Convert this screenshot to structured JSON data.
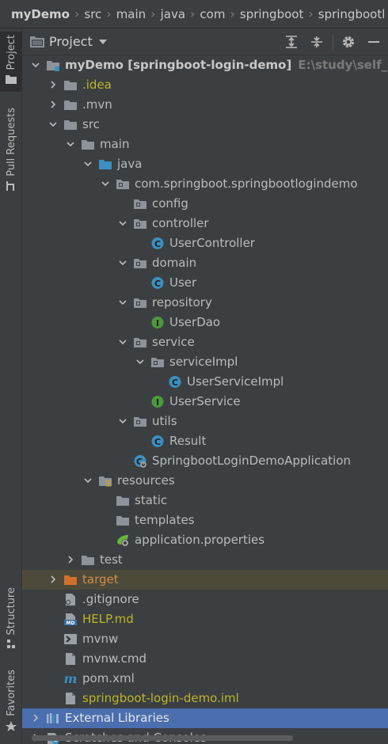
{
  "breadcrumb": [
    "myDemo",
    "src",
    "main",
    "java",
    "com",
    "springboot",
    "springbootl"
  ],
  "stripe": {
    "project": "Project",
    "pull_requests": "Pull Requests",
    "structure": "Structure",
    "favorites": "Favorites"
  },
  "panel": {
    "title": "Project"
  },
  "tree": [
    {
      "label": "myDemo",
      "suffix": " [springboot-login-demo]",
      "path": "E:\\study\\self_study\\",
      "icon": "module",
      "expanded": true,
      "depth": 0,
      "style": "bold"
    },
    {
      "label": ".idea",
      "icon": "folder",
      "expanded": false,
      "depth": 1,
      "style": "yellow"
    },
    {
      "label": ".mvn",
      "icon": "folder",
      "expanded": false,
      "depth": 1
    },
    {
      "label": "src",
      "icon": "folder",
      "expanded": true,
      "depth": 1
    },
    {
      "label": "main",
      "icon": "folder",
      "expanded": true,
      "depth": 2
    },
    {
      "label": "java",
      "icon": "folder-blue",
      "expanded": true,
      "depth": 3
    },
    {
      "label": "com.springboot.springbootlogindemo",
      "icon": "package",
      "expanded": true,
      "depth": 4
    },
    {
      "label": "config",
      "icon": "package",
      "depth": 5
    },
    {
      "label": "controller",
      "icon": "package",
      "expanded": true,
      "depth": 5
    },
    {
      "label": "UserController",
      "icon": "class",
      "depth": 6
    },
    {
      "label": "domain",
      "icon": "package",
      "expanded": true,
      "depth": 5
    },
    {
      "label": "User",
      "icon": "class",
      "depth": 6
    },
    {
      "label": "repository",
      "icon": "package",
      "expanded": true,
      "depth": 5
    },
    {
      "label": "UserDao",
      "icon": "interface",
      "depth": 6
    },
    {
      "label": "service",
      "icon": "package",
      "expanded": true,
      "depth": 5
    },
    {
      "label": "serviceImpl",
      "icon": "package",
      "expanded": true,
      "depth": 6
    },
    {
      "label": "UserServiceImpl",
      "icon": "class",
      "depth": 7
    },
    {
      "label": "UserService",
      "icon": "interface",
      "depth": 6
    },
    {
      "label": "utils",
      "icon": "package",
      "expanded": true,
      "depth": 5
    },
    {
      "label": "Result",
      "icon": "class",
      "depth": 6
    },
    {
      "label": "SpringbootLoginDemoApplication",
      "icon": "spring-class",
      "depth": 5
    },
    {
      "label": "resources",
      "icon": "resources-folder",
      "expanded": true,
      "depth": 3
    },
    {
      "label": "static",
      "icon": "folder",
      "depth": 4
    },
    {
      "label": "templates",
      "icon": "folder",
      "depth": 4
    },
    {
      "label": "application.properties",
      "icon": "spring-properties",
      "depth": 4
    },
    {
      "label": "test",
      "icon": "folder",
      "expanded": false,
      "depth": 2
    },
    {
      "label": "target",
      "icon": "folder-orange",
      "expanded": false,
      "depth": 1,
      "style": "orange",
      "row": "hover"
    },
    {
      "label": ".gitignore",
      "icon": "gitignore",
      "depth": 1
    },
    {
      "label": "HELP.md",
      "icon": "markdown",
      "depth": 1,
      "style": "yellow"
    },
    {
      "label": "mvnw",
      "icon": "terminal",
      "depth": 1
    },
    {
      "label": "mvnw.cmd",
      "icon": "file",
      "depth": 1
    },
    {
      "label": "pom.xml",
      "icon": "maven",
      "depth": 1
    },
    {
      "label": "springboot-login-demo.iml",
      "icon": "file",
      "depth": 1,
      "style": "yellow"
    },
    {
      "label": "External Libraries",
      "icon": "libraries",
      "expanded": false,
      "depth": 0,
      "row": "selected",
      "style": "white"
    },
    {
      "label": "Scratches and Consoles",
      "icon": "scratches",
      "expanded": false,
      "depth": 0
    }
  ],
  "colors": {
    "bg": "#3c3f41",
    "selection": "#4b6eaf",
    "folder": "#8d9399",
    "class": "#3d8fbf",
    "interface": "#4d9a3c",
    "yellow_text": "#bbb529",
    "orange_text": "#d08c48"
  }
}
